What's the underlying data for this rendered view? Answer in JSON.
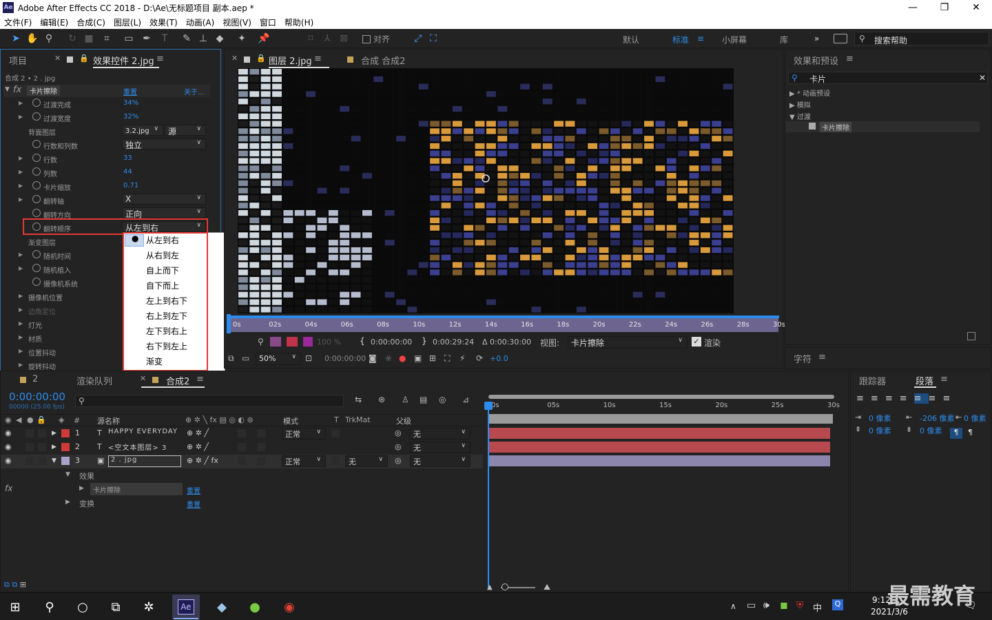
{
  "titlebar": {
    "app_icon": "Ae",
    "title": "Adobe After Effects CC 2018 - D:\\Ae\\无标题项目 副本.aep *",
    "min": "—",
    "max": "❐",
    "close": "✕"
  },
  "menu": [
    "文件(F)",
    "编辑(E)",
    "合成(C)",
    "图层(L)",
    "效果(T)",
    "动画(A)",
    "视图(V)",
    "窗口",
    "帮助(H)"
  ],
  "toolbar": {
    "snap_label": "对齐",
    "workspaces": [
      "默认",
      "标准",
      "小屏幕",
      "库"
    ],
    "active_workspace": "标准",
    "search_placeholder": "搜索帮助"
  },
  "left_panel": {
    "tab_project": "项目",
    "tab_effects": "效果控件 2.jpg",
    "path": "合成 2 • 2 . jpg",
    "effect_name": "卡片擦除",
    "reset": "重置",
    "about": "关于...",
    "props": [
      {
        "label": "过渡完成",
        "value": "34%",
        "tri": true,
        "stop": true
      },
      {
        "label": "过渡宽度",
        "value": "32%",
        "tri": true,
        "stop": true
      },
      {
        "label": "背面图层",
        "value": "",
        "tri": false,
        "stop": false
      },
      {
        "label": "行数和列数",
        "value": "",
        "tri": false,
        "stop": true
      },
      {
        "label": "行数",
        "value": "33",
        "tri": true,
        "stop": true
      },
      {
        "label": "列数",
        "value": "44",
        "tri": true,
        "stop": true
      },
      {
        "label": "卡片缩放",
        "value": "0.71",
        "tri": true,
        "stop": true
      },
      {
        "label": "翻转轴",
        "value": "",
        "tri": true,
        "stop": true
      },
      {
        "label": "翻转方向",
        "value": "",
        "tri": false,
        "stop": true
      },
      {
        "label": "翻转顺序",
        "value": "",
        "tri": false,
        "stop": true
      },
      {
        "label": "渐变图层",
        "value": "",
        "tri": false,
        "stop": false
      },
      {
        "label": "随机时间",
        "value": "",
        "tri": true,
        "stop": true
      },
      {
        "label": "随机植入",
        "value": "",
        "tri": true,
        "stop": true
      },
      {
        "label": "摄像机系统",
        "value": "",
        "tri": false,
        "stop": true
      },
      {
        "label": "摄像机位置",
        "value": "",
        "tri": true,
        "stop": false
      },
      {
        "label": "边角定位",
        "value": "",
        "tri": true,
        "stop": false
      },
      {
        "label": "灯光",
        "value": "",
        "tri": true,
        "stop": false
      },
      {
        "label": "材质",
        "value": "",
        "tri": true,
        "stop": false
      },
      {
        "label": "位置抖动",
        "value": "",
        "tri": true,
        "stop": false
      },
      {
        "label": "旋转抖动",
        "value": "",
        "tri": true,
        "stop": false
      }
    ],
    "back_layer_value": "3.2.jpg",
    "back_layer_source": "源",
    "rows_cols_value": "独立",
    "flip_axis_value": "X",
    "flip_dir_value": "正向",
    "flip_order_value": "从左到右"
  },
  "dropdown": {
    "items": [
      "从左到右",
      "从右到左",
      "自上而下",
      "自下而上",
      "左上到右下",
      "右上到左下",
      "左下到右上",
      "右下到左上",
      "渐变"
    ],
    "selected": "从左到右"
  },
  "viewer": {
    "tab_layer": "图层 2.jpg",
    "tab_comp": "合成 合成2",
    "ruler": [
      "0s",
      "02s",
      "04s",
      "06s",
      "08s",
      "10s",
      "12s",
      "14s",
      "16s",
      "18s",
      "20s",
      "22s",
      "24s",
      "26s",
      "28s",
      "30s"
    ],
    "opacity": "100 %",
    "tc_in": "0:00:00:00",
    "tc_out": "0:00:29:24",
    "tc_dur": "Δ 0:00:30:00",
    "view_label": "视图:",
    "view_value": "卡片擦除",
    "render_label": "渲染",
    "zoom": "50%",
    "time": "0:00:00:00",
    "exposure": "+0.0"
  },
  "right_panel": {
    "title": "效果和预设",
    "search_value": "卡片",
    "tree": [
      "* 动画预设",
      "模拟",
      "过渡"
    ],
    "leaf": "卡片擦除",
    "char_title": "字符"
  },
  "timeline": {
    "tabs": [
      "2",
      "渲染队列",
      "合成2"
    ],
    "timecode": "0:00:00:00",
    "fps": "00000 (25.00 fps)",
    "search_placeholder": "",
    "col_source": "源名称",
    "col_mode": "模式",
    "col_t": "T",
    "col_trkmat": "TrkMat",
    "col_parent": "父级",
    "ruler": [
      "0s",
      "05s",
      "10s",
      "15s",
      "20s",
      "25s",
      "30s"
    ],
    "layers": [
      {
        "num": "1",
        "name": "HAPPY EVERYDAY",
        "mode": "正常",
        "trk": "",
        "parent": "无",
        "color": "#cc3a3a"
      },
      {
        "num": "2",
        "name": "<空文本图层> 3",
        "mode": "",
        "trk": "",
        "parent": "无",
        "color": "#cc3a3a"
      },
      {
        "num": "3",
        "name": "2 . jpg",
        "mode": "正常",
        "trk": "无",
        "parent": "无",
        "color": "#a9a2c9"
      }
    ],
    "effects_label": "效果",
    "effect_item": "卡片擦除",
    "transform_label": "变换",
    "reset": "重置"
  },
  "para_panel": {
    "tab_tracker": "跟踪器",
    "tab_para": "段落",
    "indent_left": "0 像素",
    "indent_first": "-206 像素",
    "indent_right": "0 像素",
    "space_before": "0 像素",
    "space_after": "0 像素"
  },
  "taskbar": {
    "time": "9:12",
    "date": "2021/3/6",
    "ime": "中",
    "watermark": "最需教育"
  }
}
